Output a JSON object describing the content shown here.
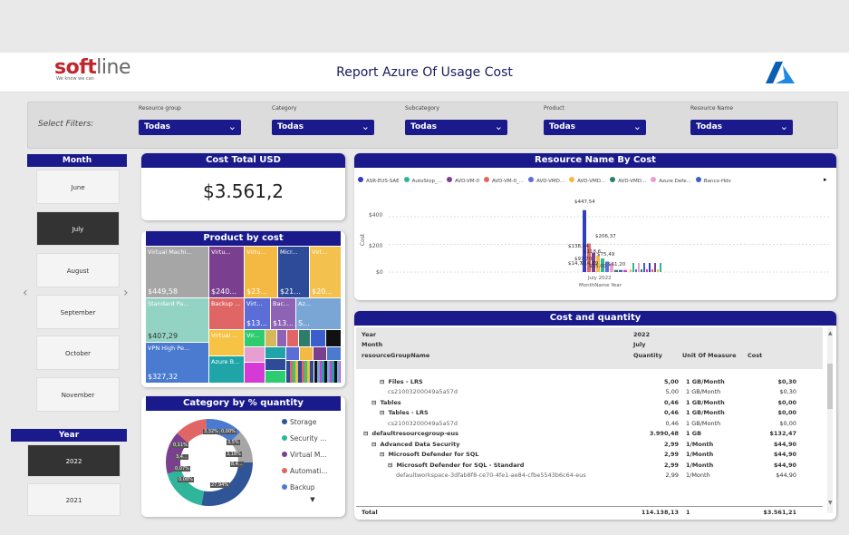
{
  "header": {
    "brand": "softline",
    "tagline": "We know we can",
    "title": "Report Azure Of Usage Cost"
  },
  "filters": {
    "label": "Select Filters:",
    "items": [
      {
        "label": "Resource group",
        "value": "Todas"
      },
      {
        "label": "Category",
        "value": "Todas"
      },
      {
        "label": "Subcategory",
        "value": "Todas"
      },
      {
        "label": "Product",
        "value": "Todas"
      },
      {
        "label": "Resource Name",
        "value": "Todas"
      }
    ]
  },
  "month_slicer": {
    "title": "Month",
    "items": [
      "June",
      "July",
      "August",
      "September",
      "October",
      "November"
    ],
    "selected": "July"
  },
  "year_slicer": {
    "title": "Year",
    "items": [
      "2022",
      "2021"
    ],
    "selected": "2022"
  },
  "cost_total": {
    "title": "Cost Total USD",
    "value": "$3.561,2"
  },
  "product_by_cost": {
    "title": "Product by cost",
    "tiles": [
      {
        "label": "Virtual Machi...",
        "value": "$449,58",
        "color": "#a6a6a6"
      },
      {
        "label": "Virtu...",
        "value": "$240...",
        "color": "#7b3f8f"
      },
      {
        "label": "Virtu...",
        "value": "$23...",
        "color": "#f4b942"
      },
      {
        "label": "Micr...",
        "value": "$21...",
        "color": "#2e4b99"
      },
      {
        "label": "Virt...",
        "value": "$20...",
        "color": "#f2c14e"
      },
      {
        "label": "Standard Pa...",
        "value": "$407,29",
        "color": "#93d3c3"
      },
      {
        "label": "Backup ...",
        "value": "",
        "color": "#e06666"
      },
      {
        "label": "Virt...",
        "value": "$13...",
        "color": "#5b6ed8"
      },
      {
        "label": "Bac...",
        "value": "$13...",
        "color": "#8e63b5"
      },
      {
        "label": "Az...",
        "value": "S...",
        "color": "#7aa6d6"
      },
      {
        "label": "VPN High Pe...",
        "value": "$327,32",
        "color": "#4a7bd0"
      },
      {
        "label": "Virtual ...",
        "value": "",
        "color": "#f6c344"
      },
      {
        "label": "Vir...",
        "value": "",
        "color": "#2ecc71"
      },
      {
        "label": "Azure B...",
        "value": "",
        "color": "#1fa5a8"
      }
    ]
  },
  "category_by_quantity": {
    "title": "Category by % quantity",
    "labels": [
      "3,32%",
      "0,00%",
      "3,5%",
      "0,11%",
      "3,18%",
      "3,4...",
      "8,4...",
      "0,07%",
      "0,08%",
      "27,94%"
    ],
    "legend": [
      {
        "name": "Storage",
        "color": "#2f5597"
      },
      {
        "name": "Security ...",
        "color": "#2fb59a"
      },
      {
        "name": "Virtual M...",
        "color": "#7b3f8f"
      },
      {
        "name": "Automati...",
        "color": "#e06666"
      },
      {
        "name": "Backup",
        "color": "#4a7bd0"
      }
    ]
  },
  "resource_chart": {
    "title": "Resource Name By Cost",
    "legend": [
      {
        "name": "ASR-EUS-SAE",
        "color": "#2f3fbf"
      },
      {
        "name": "AutoStop_...",
        "color": "#2fb59a"
      },
      {
        "name": "AVD-VM-0",
        "color": "#7b3f8f"
      },
      {
        "name": "AVD-VM-0_...",
        "color": "#e06666"
      },
      {
        "name": "AVD-VMD...",
        "color": "#5b6ed8"
      },
      {
        "name": "AVD-VMD...",
        "color": "#f4b942"
      },
      {
        "name": "AVD-VMD...",
        "color": "#2e7d6b"
      },
      {
        "name": "Azure Defe...",
        "color": "#e79fd1"
      },
      {
        "name": "Banco-Hdv",
        "color": "#3a5fcd"
      }
    ],
    "ylabel": "Cost",
    "xlabel": "MonthName Year",
    "xtick": "July 2022",
    "yticks": [
      "$400",
      "$200",
      "$0"
    ],
    "data_labels": [
      "$447,54",
      "$206,37",
      "$138,64",
      "$118,6",
      "$97,70",
      "$75,49",
      "$14,7",
      "$14,89",
      "$15,00",
      "$61,20"
    ]
  },
  "chart_data": {
    "type": "bar",
    "title": "Resource Name By Cost",
    "xlabel": "MonthName Year",
    "ylabel": "Cost",
    "categories": [
      "July 2022"
    ],
    "ylim": [
      0,
      450
    ],
    "series_values": [
      447.54,
      206.37,
      138.64,
      118.6,
      97.7,
      75.49,
      61.2,
      15.0,
      14.89,
      14.7
    ]
  },
  "cost_quantity": {
    "title": "Cost and quantity",
    "header": {
      "row1": [
        "Year",
        "2022",
        "",
        ""
      ],
      "row2": [
        "Month",
        "July",
        "",
        ""
      ],
      "row3": [
        "resourceGroupName",
        "Quantity",
        "Unit Of Measure",
        "Cost"
      ]
    },
    "rows": [
      {
        "name": "Files - LRS",
        "qty": "5,00",
        "unit": "1 GB/Month",
        "cost": "$0,30",
        "indent": 2,
        "bold": true,
        "toggle": "⊟"
      },
      {
        "name": "cs21003200049a5a57d",
        "qty": "5,00",
        "unit": "1 GB/Month",
        "cost": "$0,30",
        "indent": 3,
        "bold": false,
        "toggle": ""
      },
      {
        "name": "Tables",
        "qty": "0,46",
        "unit": "1 GB/Month",
        "cost": "$0,00",
        "indent": 1,
        "bold": true,
        "toggle": "⊟"
      },
      {
        "name": "Tables - LRS",
        "qty": "0,46",
        "unit": "1 GB/Month",
        "cost": "$0,00",
        "indent": 2,
        "bold": true,
        "toggle": "⊟"
      },
      {
        "name": "cs21003200049a5a57d",
        "qty": "0,46",
        "unit": "1 GB/Month",
        "cost": "$0,00",
        "indent": 3,
        "bold": false,
        "toggle": ""
      },
      {
        "name": "defaultresourcegroup-eus",
        "qty": "3.990,48",
        "unit": "1 GB",
        "cost": "$132,47",
        "indent": 0,
        "bold": true,
        "toggle": "⊟"
      },
      {
        "name": "Advanced Data Security",
        "qty": "2,99",
        "unit": "1/Month",
        "cost": "$44,90",
        "indent": 1,
        "bold": true,
        "toggle": "⊟"
      },
      {
        "name": "Microsoft Defender for SQL",
        "qty": "2,99",
        "unit": "1/Month",
        "cost": "$44,90",
        "indent": 2,
        "bold": true,
        "toggle": "⊟"
      },
      {
        "name": "Microsoft Defender for SQL - Standard",
        "qty": "2,99",
        "unit": "1/Month",
        "cost": "$44,90",
        "indent": 3,
        "bold": true,
        "toggle": "⊟"
      },
      {
        "name": "defaultworkspace-3dfab8f8-ce70-4fe1-ae84-cfbe5543b6c64-eus",
        "qty": "2,99",
        "unit": "1/Month",
        "cost": "$44,90",
        "indent": 4,
        "bold": false,
        "toggle": ""
      }
    ],
    "total": {
      "name": "Total",
      "qty": "114.138,13",
      "unit": "1",
      "cost": "$3.561,21"
    }
  }
}
